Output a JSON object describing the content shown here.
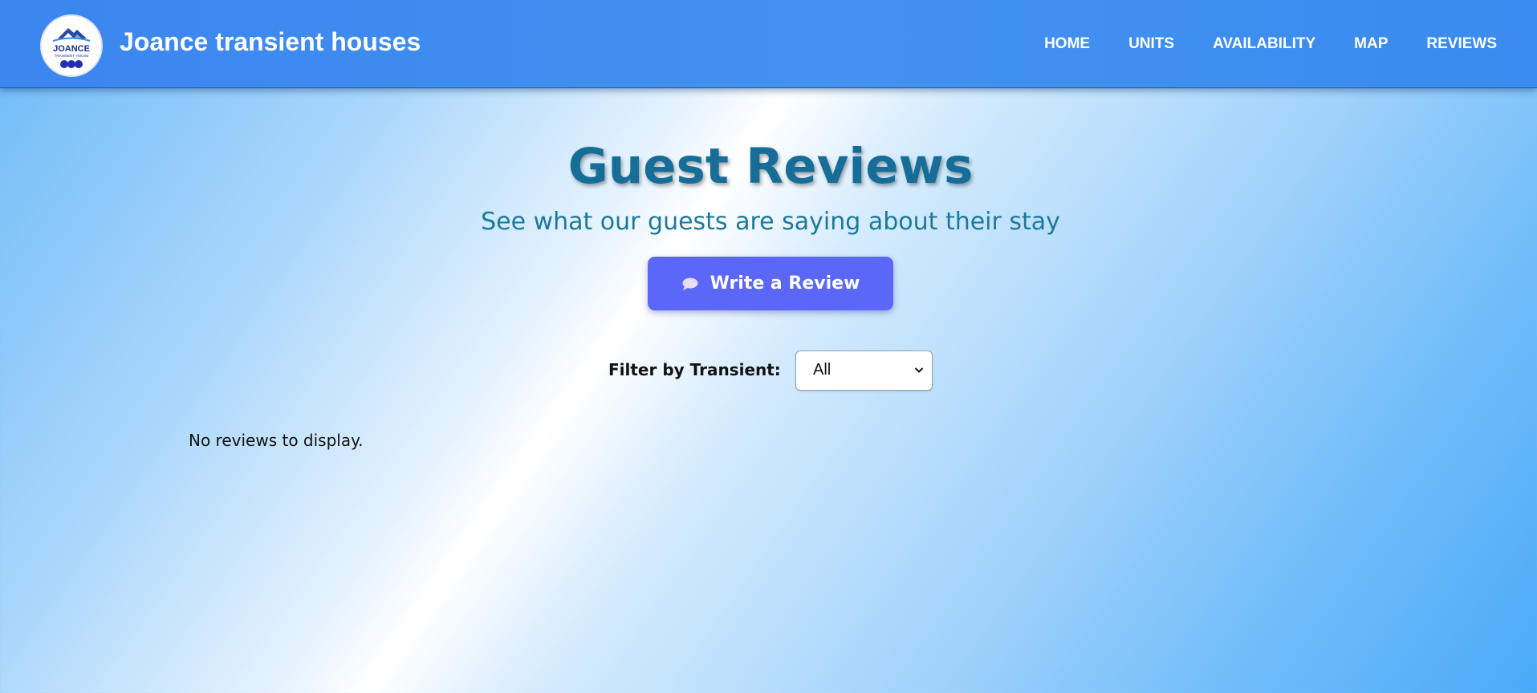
{
  "header": {
    "logo_text": "JOANCE",
    "logo_subtext": "TRANSIENT HOUSE",
    "brand": "Joance transient houses",
    "nav": [
      {
        "label": "HOME"
      },
      {
        "label": "UNITS"
      },
      {
        "label": "AVAILABILITY"
      },
      {
        "label": "MAP"
      },
      {
        "label": "REVIEWS"
      }
    ]
  },
  "main": {
    "title": "Guest Reviews",
    "subtitle": "See what our guests are saying about their stay",
    "write_review": {
      "icon": "speech-bubble-icon",
      "label": "Write a Review"
    },
    "filter": {
      "label": "Filter by Transient:",
      "selected": "All"
    },
    "empty_message": "No reviews to display."
  },
  "colors": {
    "navbar": "#4291f1",
    "title": "#166e98",
    "subtitle": "#1b7a9b",
    "button": "#5a67f8"
  }
}
